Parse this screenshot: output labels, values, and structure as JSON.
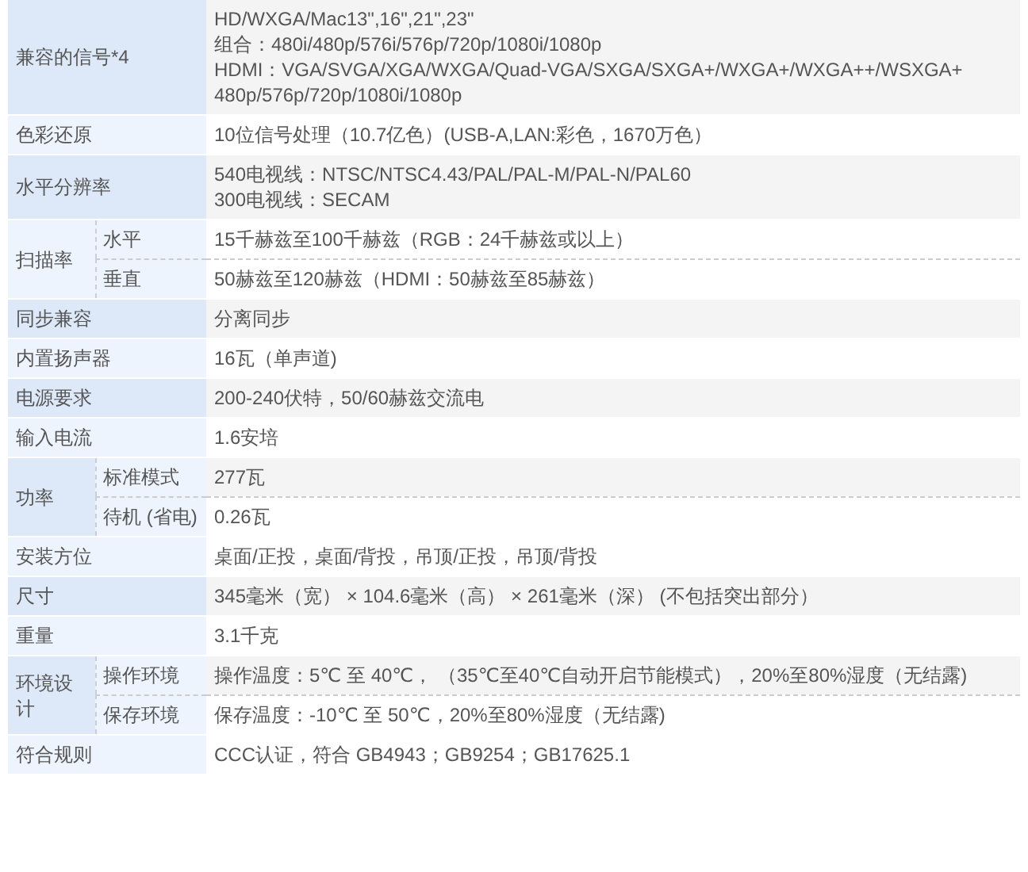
{
  "rows": [
    {
      "kind": "single",
      "label": "兼容的信号*4",
      "lines": [
        "HD/WXGA/Mac13\",16\",21\",23\"",
        "组合：480i/480p/576i/576p/720p/1080i/1080p",
        "HDMI：VGA/SVGA/XGA/WXGA/Quad-VGA/SXGA/SXGA+/WXGA+/WXGA++/WSXGA+",
        "480p/576p/720p/1080i/1080p"
      ]
    },
    {
      "kind": "single",
      "label": "色彩还原",
      "lines": [
        "10位信号处理（10.7亿色）(USB-A,LAN:彩色，1670万色）"
      ]
    },
    {
      "kind": "single",
      "label": "水平分辨率",
      "lines": [
        "540电视线：NTSC/NTSC4.43/PAL/PAL-M/PAL-N/PAL60",
        "300电视线：SECAM"
      ]
    },
    {
      "kind": "group",
      "label": "扫描率",
      "children": [
        {
          "label": "水平",
          "value": "15千赫兹至100千赫兹（RGB：24千赫兹或以上）"
        },
        {
          "label": "垂直",
          "value": "50赫兹至120赫兹（HDMI：50赫兹至85赫兹）"
        }
      ]
    },
    {
      "kind": "single",
      "label": "同步兼容",
      "lines": [
        "分离同步"
      ]
    },
    {
      "kind": "single",
      "label": "内置扬声器",
      "lines": [
        "16瓦（单声道)"
      ]
    },
    {
      "kind": "single",
      "label": "电源要求",
      "lines": [
        "200-240伏特，50/60赫兹交流电"
      ]
    },
    {
      "kind": "single",
      "label": "输入电流",
      "lines": [
        "1.6安培"
      ]
    },
    {
      "kind": "group",
      "label": "功率",
      "children": [
        {
          "label": "标准模式",
          "value": "277瓦"
        },
        {
          "label": "待机 (省电)",
          "value": "0.26瓦"
        }
      ]
    },
    {
      "kind": "single",
      "label": "安装方位",
      "lines": [
        "桌面/正投，桌面/背投，吊顶/正投，吊顶/背投"
      ]
    },
    {
      "kind": "single",
      "label": "尺寸",
      "lines": [
        "345毫米（宽） × 104.6毫米（高） × 261毫米（深） (不包括突出部分）"
      ]
    },
    {
      "kind": "single",
      "label": "重量",
      "lines": [
        "3.1千克"
      ]
    },
    {
      "kind": "group",
      "label": "环境设计",
      "children": [
        {
          "label": "操作环境",
          "value": "操作温度：5℃ 至 40℃， （35℃至40℃自动开启节能模式），20%至80%湿度（无结露)"
        },
        {
          "label": "保存环境",
          "value": "保存温度：-10℃ 至 50℃，20%至80%湿度（无结露)"
        }
      ]
    },
    {
      "kind": "single",
      "label": "符合规则",
      "lines": [
        "CCC认证，符合 GB4943；GB9254；GB17625.1"
      ]
    }
  ]
}
